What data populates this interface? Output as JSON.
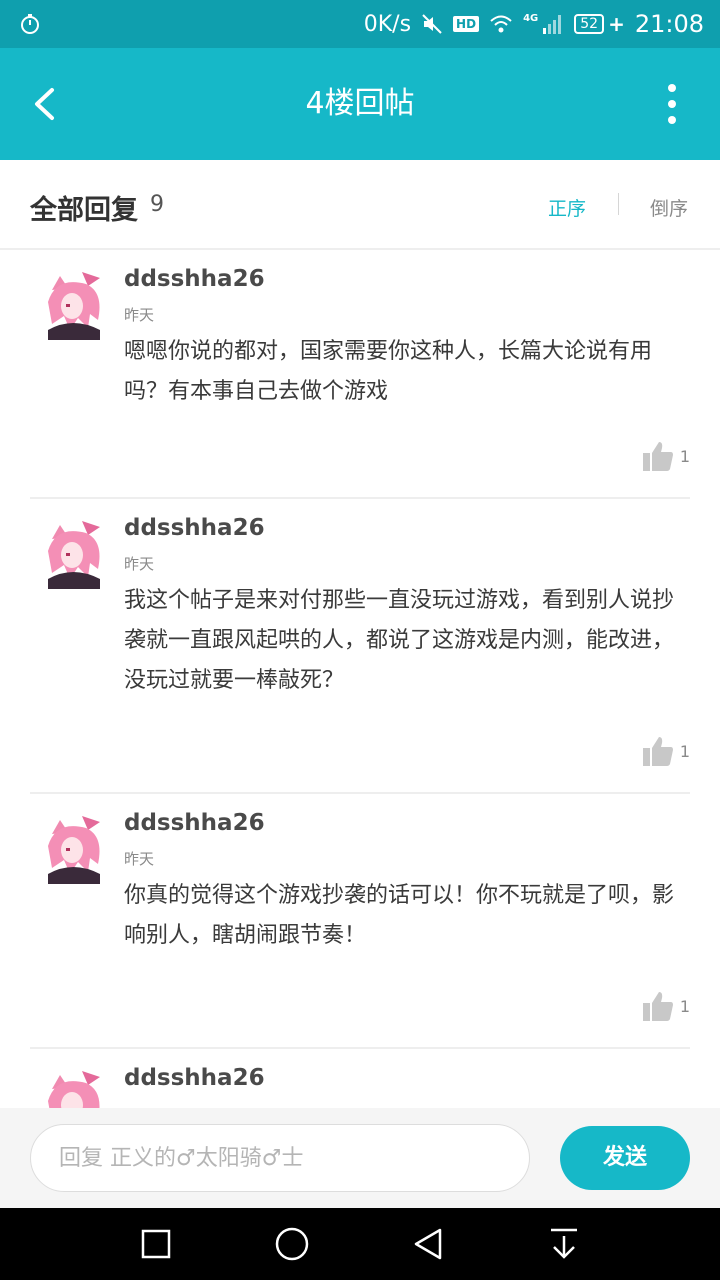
{
  "status_bar": {
    "speed": "0K/s",
    "hd_label": "HD",
    "network_label": "4G",
    "battery": "52",
    "time": "21:08"
  },
  "header": {
    "title": "4楼回帖",
    "back_icon": "chevron-left-icon",
    "more_icon": "more-vertical-icon"
  },
  "reply_header": {
    "title": "全部回复",
    "count": "9",
    "sort_asc": "正序",
    "sort_desc": "倒序"
  },
  "replies": [
    {
      "username": "ddsshha26",
      "time": "昨天",
      "content": "嗯嗯你说的都对，国家需要你这种人，长篇大论说有用吗？有本事自己去做个游戏",
      "likes": "1"
    },
    {
      "username": "ddsshha26",
      "time": "昨天",
      "content": "我这个帖子是来对付那些一直没玩过游戏，看到别人说抄袭就一直跟风起哄的人，都说了这游戏是内测，能改进，没玩过就要一棒敲死？",
      "likes": "1"
    },
    {
      "username": "ddsshha26",
      "time": "昨天",
      "content": "你真的觉得这个游戏抄袭的话可以！你不玩就是了呗，影响别人，瞎胡闹跟节奏！",
      "likes": "1"
    },
    {
      "username": "ddsshha26"
    }
  ],
  "input": {
    "placeholder": "回复 正义的♂太阳骑♂士",
    "send_label": "发送"
  },
  "colors": {
    "status_bar": "#0f9fae",
    "accent": "#16b8c8",
    "text_primary": "#3a3a3a",
    "text_secondary": "#8a8a8a"
  }
}
